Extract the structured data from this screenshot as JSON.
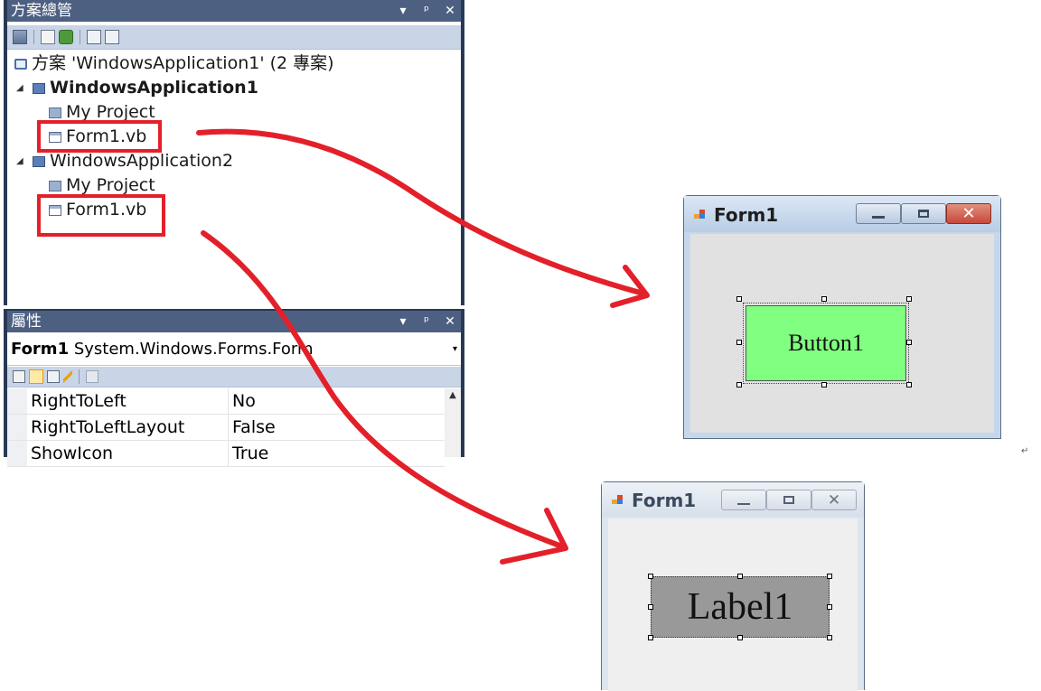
{
  "solution_explorer": {
    "title": "方案總管",
    "pane_buttons": [
      "▾",
      "ᵖ",
      "✕"
    ],
    "tree": {
      "solution": "方案 'WindowsApplication1' (2 專案)",
      "project1": "WindowsApplication1",
      "project1_myproject": "My Project",
      "project1_form": "Form1.vb",
      "project2": "WindowsApplication2",
      "project2_myproject": "My Project",
      "project2_form": "Form1.vb"
    }
  },
  "properties": {
    "title": "屬性",
    "pane_buttons": [
      "▾",
      "ᵖ",
      "✕"
    ],
    "object_name": "Form1",
    "object_type": "System.Windows.Forms.Form",
    "rows": [
      {
        "key": "RightToLeft",
        "value": "No"
      },
      {
        "key": "RightToLeftLayout",
        "value": "False"
      },
      {
        "key": "ShowIcon",
        "value": "True"
      }
    ]
  },
  "form_a": {
    "title": "Form1",
    "control_label": "Button1",
    "control_color": "#80ff80",
    "title_bar_color": "#bfd2e8",
    "close_button_color": "#c8493a"
  },
  "form_b": {
    "title": "Form1",
    "control_label": "Label1",
    "control_color": "#999999",
    "title_bar_color": "#dde5ee"
  },
  "arrow_color": "#e3202a",
  "return_mark": "↵"
}
